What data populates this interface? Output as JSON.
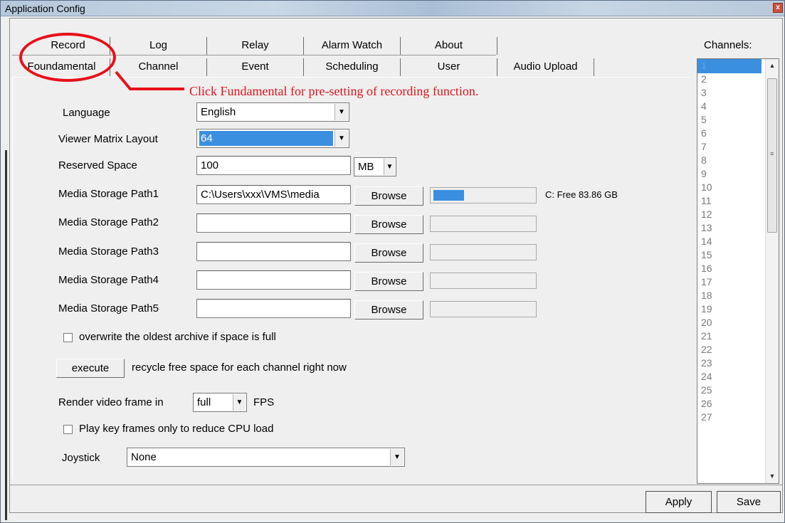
{
  "window": {
    "title": "Application Config",
    "close_glyph": "x"
  },
  "tabs_row1": [
    "Record",
    "Log",
    "Relay",
    "Alarm Watch",
    "About"
  ],
  "tabs_row2": [
    "Foundamental",
    "Channel",
    "Event",
    "Scheduling",
    "User",
    "Audio Upload"
  ],
  "annotation": {
    "text": "Click Fundamental for pre-setting of recording function.",
    "color": "#e0141b"
  },
  "form": {
    "language": {
      "label": "Language",
      "value": "English"
    },
    "viewer_matrix": {
      "label": "Viewer Matrix Layout",
      "value": "64"
    },
    "reserved_space": {
      "label": "Reserved Space",
      "value": "100",
      "unit": "MB"
    },
    "paths": [
      {
        "label": "Media Storage Path1",
        "value": "C:\\Users\\xxx\\VMS\\media",
        "button": "Browse",
        "usage": 0.3,
        "status": "C: Free 83.86 GB"
      },
      {
        "label": "Media Storage Path2",
        "value": "",
        "button": "Browse",
        "usage": 0,
        "status": ""
      },
      {
        "label": "Media Storage Path3",
        "value": "",
        "button": "Browse",
        "usage": 0,
        "status": ""
      },
      {
        "label": "Media Storage Path4",
        "value": "",
        "button": "Browse",
        "usage": 0,
        "status": ""
      },
      {
        "label": "Media Storage Path5",
        "value": "",
        "button": "Browse",
        "usage": 0,
        "status": ""
      }
    ],
    "overwrite": {
      "label": "overwrite the oldest archive if space is full",
      "checked": false
    },
    "execute": {
      "button": "execute",
      "text": "recycle free space for each channel right now"
    },
    "render": {
      "label": "Render video frame in",
      "value": "full",
      "suffix": "FPS"
    },
    "keyframes": {
      "label": "Play key frames only to reduce CPU load",
      "checked": false
    },
    "joystick": {
      "label": "Joystick",
      "value": "None"
    }
  },
  "channels": {
    "label": "Channels:",
    "items": [
      "1",
      "2",
      "3",
      "4",
      "5",
      "6",
      "7",
      "8",
      "9",
      "10",
      "11",
      "12",
      "13",
      "14",
      "15",
      "16",
      "17",
      "18",
      "19",
      "20",
      "21",
      "22",
      "23",
      "24",
      "25",
      "26",
      "27"
    ],
    "selected": "1"
  },
  "footer": {
    "apply": "Apply",
    "save": "Save"
  },
  "icons": {
    "dropdown": "chevron-down-icon",
    "scroll_up": "arrow-up-icon",
    "scroll_down": "arrow-down-icon"
  },
  "colors": {
    "accent": "#3b8fe0",
    "annotation": "#e0141b"
  }
}
